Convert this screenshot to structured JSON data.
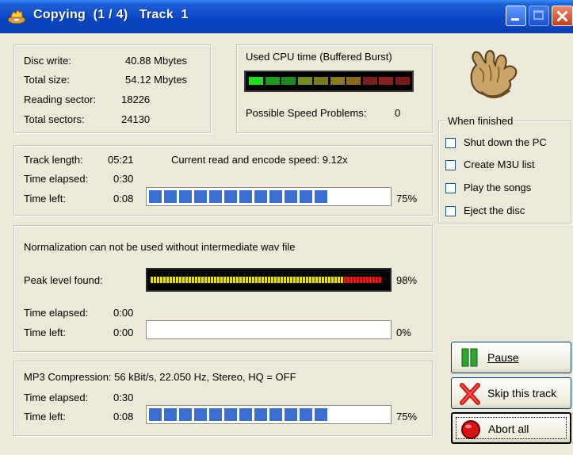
{
  "window": {
    "title": "Copying  (1 / 4)   Track  1"
  },
  "disc": {
    "disc_write_label": "Disc write:",
    "disc_write_value": "40.88 Mbytes",
    "total_size_label": "Total size:",
    "total_size_value": "54.12 Mbytes",
    "reading_sector_label": "Reading sector:",
    "reading_sector_value": "18226",
    "total_sectors_label": "Total sectors:",
    "total_sectors_value": "24130"
  },
  "cpu": {
    "title": "Used CPU time (Buffered Burst)",
    "segment_colors": [
      "#22dd22",
      "#1f9a1f",
      "#1f8a1f",
      "#6f8a1f",
      "#7a7a1f",
      "#8a7a1f",
      "#8a6a1f",
      "#7a1f1f",
      "#8a1f1f",
      "#7a1a1a"
    ],
    "speed_problems_label": "Possible Speed Problems:",
    "speed_problems_value": "0"
  },
  "track": {
    "track_length_label": "Track length:",
    "track_length_value": "05:21",
    "read_speed_text": "Current read and encode speed: 9.12x",
    "time_elapsed_label": "Time elapsed:",
    "time_elapsed_value": "0:30",
    "time_left_label": "Time left:",
    "time_left_value": "0:08",
    "progress_text": "75%",
    "progress": 0.75
  },
  "normalization": {
    "message": "Normalization can not be used without intermediate wav file",
    "peak_label": "Peak level found:",
    "peak_text": "98%",
    "peak_level": 0.98,
    "time_elapsed_label": "Time elapsed:",
    "time_elapsed_value": "0:00",
    "time_left_label": "Time left:",
    "time_left_value": "0:00",
    "progress_text": "0%",
    "progress": 0
  },
  "mp3": {
    "info": "MP3 Compression: 56 kBit/s, 22.050 Hz, Stereo, HQ = OFF",
    "time_elapsed_label": "Time elapsed:",
    "time_elapsed_value": "0:30",
    "time_left_label": "Time left:",
    "time_left_value": "0:08",
    "progress_text": "75%",
    "progress": 0.75
  },
  "when_finished": {
    "title": "When finished",
    "options": [
      {
        "label": "Shut down the PC",
        "checked": false
      },
      {
        "label": "Create M3U list",
        "checked": false
      },
      {
        "label": "Play the songs",
        "checked": false
      },
      {
        "label": "Eject the disc",
        "checked": false
      }
    ]
  },
  "buttons": {
    "pause_label": "Pause",
    "skip_label": "Skip this track",
    "abort_label": "Abort all"
  },
  "icons": {
    "app": "burning-cd-icon",
    "hand": "hand-icon",
    "pause": "pause-icon",
    "skip": "skip-x-icon",
    "abort": "red-stop-icon"
  },
  "colors": {
    "titlebar": "#0a46c4",
    "progress_segment": "#3a6fd0",
    "peak_yellow": "#e8e000",
    "peak_red": "#dd1a1a"
  }
}
